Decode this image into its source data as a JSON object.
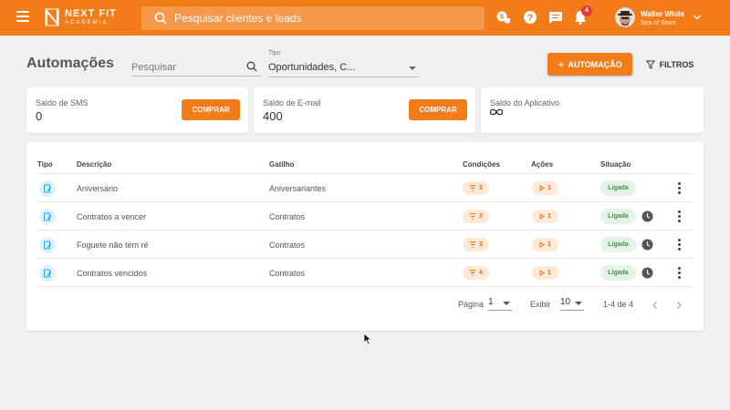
{
  "topbar": {
    "brand_name": "NEXT FIT",
    "brand_sub": "ACADEMIA",
    "search_placeholder": "Pesquisar clientes e leads",
    "notification_count": "4",
    "user_name": "Walter White",
    "user_org": "Sea of Stars",
    "icons": [
      "menu-icon",
      "search-icon",
      "money-chat-icon",
      "help-icon",
      "chat-icon",
      "bell-icon",
      "chevron-down-icon"
    ]
  },
  "header": {
    "title": "Automações",
    "search_placeholder": "Pesquisar",
    "type_label": "Tipo",
    "type_value": "Oportunidades, C...",
    "add_button": "AUTOMAÇÃO",
    "filters_button": "FILTROS"
  },
  "cards": [
    {
      "label": "Saldo de SMS",
      "value": "0",
      "button": "COMPRAR"
    },
    {
      "label": "Saldo de E-mail",
      "value": "400",
      "button": "COMPRAR"
    },
    {
      "label": "Saldo do Aplicativo",
      "value_icon": "infinity-icon"
    }
  ],
  "table": {
    "columns": [
      "Tipo",
      "Descrição",
      "Gatilho",
      "Condições",
      "Ações",
      "Situação"
    ],
    "rows": [
      {
        "description": "Aniversário",
        "trigger": "Aniversariantes",
        "conditions": "3",
        "actions": "1",
        "status": "Ligada",
        "scheduled": false
      },
      {
        "description": "Contratos a vencer",
        "trigger": "Contratos",
        "conditions": "3",
        "actions": "1",
        "status": "Ligada",
        "scheduled": true
      },
      {
        "description": "Foguete não tem ré",
        "trigger": "Contratos",
        "conditions": "3",
        "actions": "1",
        "status": "Ligada",
        "scheduled": true
      },
      {
        "description": "Contratos vencidos",
        "trigger": "Contratos",
        "conditions": "4",
        "actions": "1",
        "status": "Ligada",
        "scheduled": true
      }
    ]
  },
  "pagination": {
    "page_label": "Página",
    "page_value": "1",
    "show_label": "Exibir",
    "show_value": "10",
    "range": "1-4 de 4"
  },
  "colors": {
    "brand": "#f27b1a",
    "status_on": "#3a9a3a",
    "pill_bg": "#fde9d6"
  }
}
